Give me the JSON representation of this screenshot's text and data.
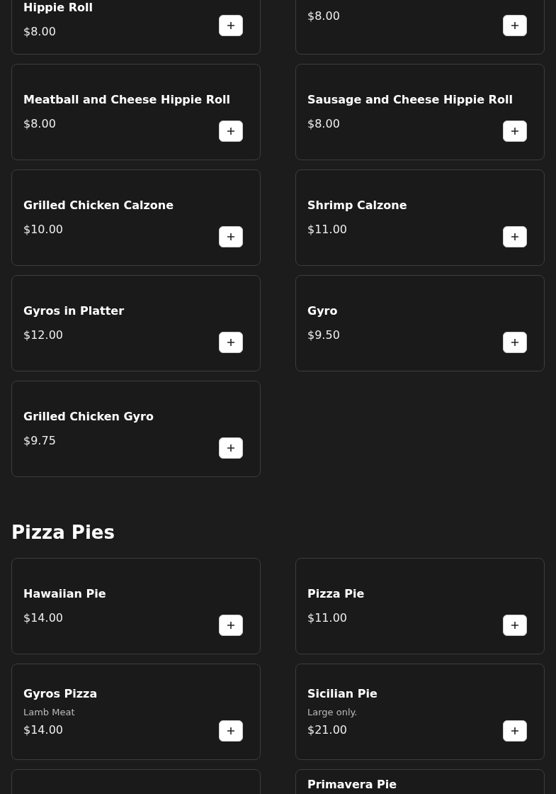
{
  "sections": [
    {
      "items": [
        {
          "kind": "item",
          "title": "Hippie Roll",
          "price": "$8.00"
        },
        {
          "kind": "item",
          "price": "$8.00"
        },
        {
          "kind": "item",
          "title": "Meatball and Cheese Hippie Roll",
          "price": "$8.00"
        },
        {
          "kind": "item",
          "title": "Sausage and Cheese Hippie Roll",
          "price": "$8.00"
        },
        {
          "kind": "item",
          "title": "Grilled Chicken Calzone",
          "price": "$10.00"
        },
        {
          "kind": "item",
          "title": "Shrimp Calzone",
          "price": "$11.00"
        },
        {
          "kind": "item",
          "title": "Gyros in Platter",
          "price": "$12.00"
        },
        {
          "kind": "item",
          "title": "Gyro",
          "price": "$9.50"
        },
        {
          "kind": "item",
          "title": "Grilled Chicken Gyro",
          "price": "$9.75"
        }
      ]
    },
    {
      "heading": "Pizza Pies",
      "items": [
        {
          "kind": "item",
          "title": "Hawaiian Pie",
          "price": "$14.00"
        },
        {
          "kind": "item",
          "title": "Pizza Pie",
          "price": "$11.00"
        },
        {
          "kind": "item",
          "title": "Gyros Pizza",
          "description": "Lamb Meat",
          "price": "$14.00"
        },
        {
          "kind": "item",
          "title": "Sicilian Pie",
          "description": "Large only.",
          "price": "$21.00"
        },
        {
          "kind": "empty"
        },
        {
          "kind": "item",
          "title": "Primavera Pie"
        }
      ]
    }
  ]
}
